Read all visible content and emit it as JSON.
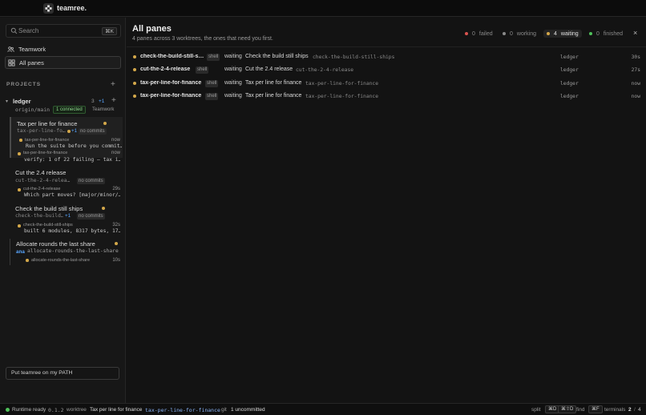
{
  "app": {
    "title": "teamree."
  },
  "sidebar": {
    "search_placeholder": "Search",
    "search_shortcut": "⌘K",
    "nav": [
      {
        "label": "Teamwork",
        "icon": "teamwork-icon"
      },
      {
        "label": "All panes",
        "icon": "grid-icon",
        "active": true
      }
    ],
    "projects_label": "PROJECTS",
    "project": {
      "name": "ledger",
      "count": "3",
      "delta": "+1",
      "branch": "origin/main",
      "connected": "1 connected",
      "team_label": "Teamwork"
    },
    "worktrees": [
      {
        "title": "Tax per line for finance",
        "slug": "tax-per-line-fo…",
        "delta": "+1",
        "badge": "no commits",
        "active": true,
        "panes": [
          {
            "name": "tax-per-line-for-finance",
            "time": "now",
            "message": "Run the suite before you commit…"
          },
          {
            "name": "tax-per-line-for-finance",
            "time": "now",
            "message": "verify: 1 of 22 failing — tax i…"
          }
        ]
      },
      {
        "title": "Cut the 2.4 release",
        "slug": "cut-the-2-4-relea…",
        "badge": "no commits",
        "panes": [
          {
            "name": "cut-the-2-4-release",
            "time": "29s",
            "message": "Which part moves? [major/minor/…"
          }
        ]
      },
      {
        "title": "Check the build still ships",
        "slug": "check-the-build…",
        "delta": "+1",
        "badge": "no commits",
        "panes": [
          {
            "name": "check-the-build-still-ships",
            "time": "32s",
            "message": "built 6 modules, 8317 bytes, 17…"
          }
        ]
      },
      {
        "title": "Allocate rounds the last share",
        "author": "ana",
        "slug": "allocate-rounds-the-last-share",
        "panes": [
          {
            "name": "allocate-rounds-the-last-share",
            "time": "10s"
          }
        ]
      }
    ],
    "path_button": "Put teamree on my PATH"
  },
  "main": {
    "title": "All panes",
    "subtitle": "4 panes across 3 worktrees, the ones that need you first.",
    "status_filters": [
      {
        "count": "0",
        "label": "failed",
        "color": "#d9534f"
      },
      {
        "count": "0",
        "label": "working",
        "color": "#8a8a8a"
      },
      {
        "count": "4",
        "label": "waiting",
        "color": "#d4a84a",
        "active": true
      },
      {
        "count": "0",
        "label": "finished",
        "color": "#4fc15a"
      }
    ],
    "close_label": "×",
    "rows": [
      {
        "name": "check-the-build-still-s…",
        "shell": "shell",
        "status": "waiting",
        "task": "Check the build still ships",
        "branch": "check-the-build-still-ships",
        "project": "ledger",
        "time": "30s"
      },
      {
        "name": "cut-the-2-4-release",
        "shell": "shell",
        "status": "waiting",
        "task": "Cut the 2.4 release",
        "branch": "cut-the-2-4-release",
        "project": "ledger",
        "time": "27s"
      },
      {
        "name": "tax-per-line-for-finance",
        "shell": "shell",
        "status": "waiting",
        "task": "Tax per line for finance",
        "branch": "tax-per-line-for-finance",
        "project": "ledger",
        "time": "now"
      },
      {
        "name": "tax-per-line-for-finance",
        "shell": "shell",
        "status": "waiting",
        "task": "Tax per line for finance",
        "branch": "tax-per-line-for-finance",
        "project": "ledger",
        "time": "now"
      }
    ]
  },
  "statusbar": {
    "runtime": "Runtime ready",
    "version": "0.1.2",
    "worktree_label": "worktree",
    "worktree_name": "Tax per line for finance",
    "worktree_branch": "tax-per-line-for-finance",
    "git_label": "git",
    "git_status": "1 uncommitted",
    "split_label": "split",
    "split_key1": "⌘D",
    "split_key2": "⌘⇧D",
    "find_label": "find",
    "find_key": "⌘F",
    "terminals_label": "terminals",
    "terminals_current": "2",
    "terminals_sep": "/",
    "terminals_total": "4"
  }
}
